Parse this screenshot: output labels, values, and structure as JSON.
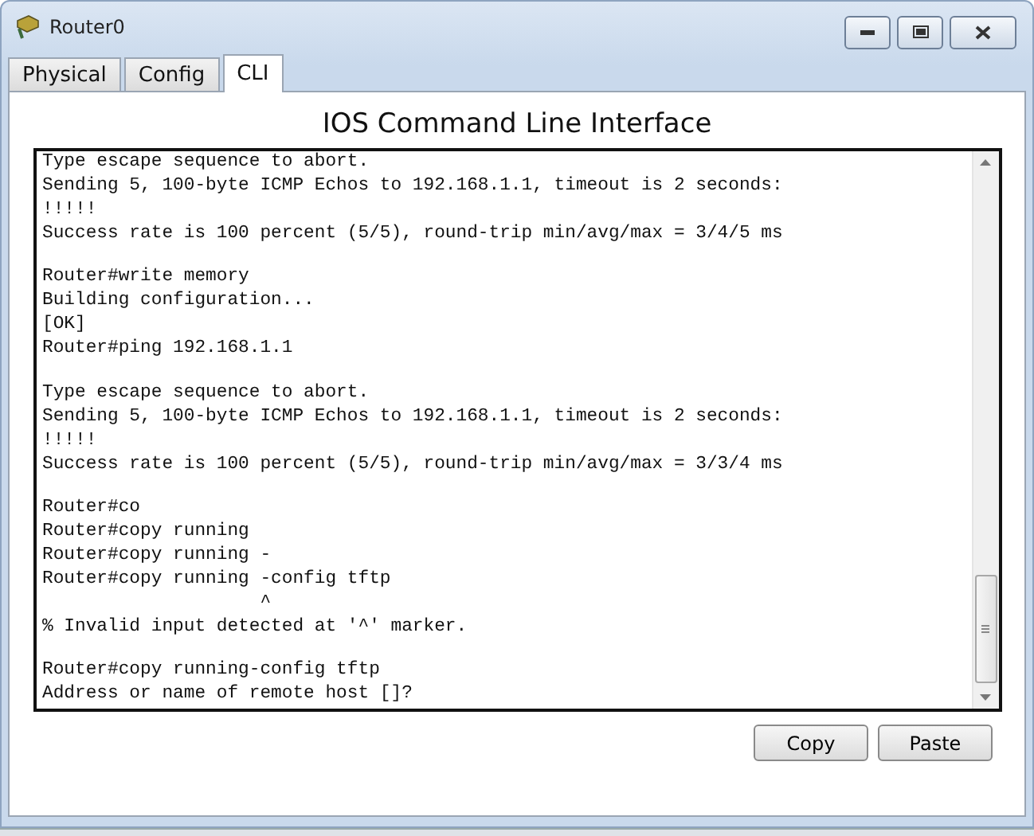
{
  "window": {
    "title": "Router0"
  },
  "tabs": [
    {
      "label": "Physical",
      "selected": false
    },
    {
      "label": "Config",
      "selected": false
    },
    {
      "label": "CLI",
      "selected": true
    }
  ],
  "heading": "IOS Command Line Interface",
  "terminal": {
    "blocks": [
      [
        "Type escape sequence to abort.",
        "Sending 5, 100-byte ICMP Echos to 192.168.1.1, timeout is 2 seconds:",
        "!!!!!",
        "Success rate is 100 percent (5/5), round-trip min/avg/max = 3/4/5 ms"
      ],
      [
        "Router#write memory",
        "Building configuration...",
        "[OK]",
        "Router#ping 192.168.1.1"
      ],
      [
        "Type escape sequence to abort.",
        "Sending 5, 100-byte ICMP Echos to 192.168.1.1, timeout is 2 seconds:",
        "!!!!!",
        "Success rate is 100 percent (5/5), round-trip min/avg/max = 3/3/4 ms"
      ],
      [
        "Router#co",
        "Router#copy running",
        "Router#copy running -",
        "Router#copy running -config tftp",
        "                    ^",
        "% Invalid input detected at '^' marker."
      ],
      [
        "Router#copy running-config tftp",
        "Address or name of remote host []?"
      ]
    ]
  },
  "buttons": [
    "Copy",
    "Paste"
  ]
}
